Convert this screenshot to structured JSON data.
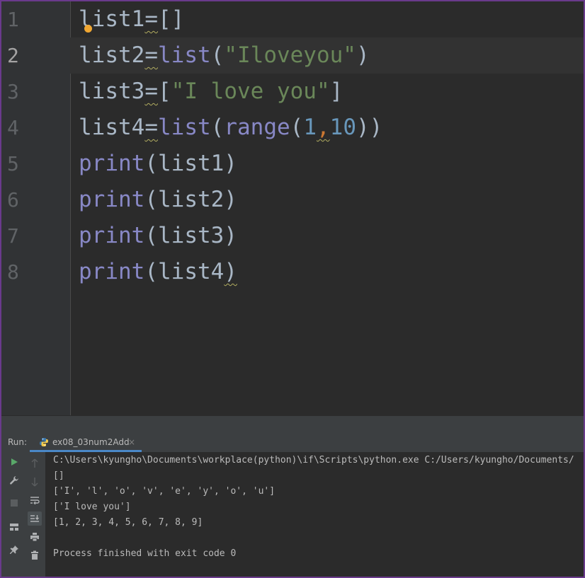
{
  "editor": {
    "lines": [
      {
        "number": "1"
      },
      {
        "number": "2"
      },
      {
        "number": "3"
      },
      {
        "number": "4"
      },
      {
        "number": "5"
      },
      {
        "number": "6"
      },
      {
        "number": "7"
      },
      {
        "number": "8"
      }
    ],
    "tokens": {
      "l1_var": "list1",
      "l1_op": "=",
      "l1_rest": "[]",
      "l2_var": "list2",
      "l2_op": "=",
      "l2_fn": "list",
      "l2_open": "(",
      "l2_str": "\"Iloveyou\"",
      "l2_close": ")",
      "l3_var": "list3",
      "l3_op": "=",
      "l3_open": "[",
      "l3_str": "\"I love you\"",
      "l3_close": "]",
      "l4_var": "list4",
      "l4_op": "=",
      "l4_fn": "list",
      "l4_open": "(",
      "l4_fn2": "range",
      "l4_open2": "(",
      "l4_num1": "1",
      "l4_comma": ",",
      "l4_num2": "10",
      "l4_close": "))",
      "l5_fn": "print",
      "l5_arg": "(list1)",
      "l6_fn": "print",
      "l6_arg": "(list2)",
      "l7_fn": "print",
      "l7_arg": "(list3)",
      "l8_fn": "print",
      "l8_arg": "(list4",
      "l8_close": ")"
    }
  },
  "run_panel": {
    "label": "Run:",
    "tab_label": "ex08_03num2Add",
    "close_glyph": "×",
    "console_lines": [
      "C:\\Users\\kyungho\\Documents\\workplace(python)\\if\\Scripts\\python.exe C:/Users/kyungho/Documents/",
      "[]",
      "['I', 'l', 'o', 'v', 'e', 'y', 'o', 'u']",
      "['I love you']",
      "[1, 2, 3, 4, 5, 6, 7, 8, 9]",
      "",
      "Process finished with exit code 0"
    ]
  },
  "toolbar": {
    "icons": [
      "run-icon",
      "wrench-icon",
      "stop-icon",
      "layout-icon",
      "pin-icon",
      "up-arrow-icon",
      "down-arrow-icon",
      "soft-wrap-icon",
      "scroll-to-end-icon",
      "print-icon",
      "trash-icon"
    ]
  },
  "colors": {
    "background": "#2b2b2b",
    "gutter": "#313335",
    "string": "#6a8759",
    "number": "#6897bb",
    "builtin": "#8888c6",
    "text": "#a9b7c6",
    "frame_border": "#6a3a8c",
    "run_green": "#59a869",
    "tab_underline": "#4a88c7"
  }
}
